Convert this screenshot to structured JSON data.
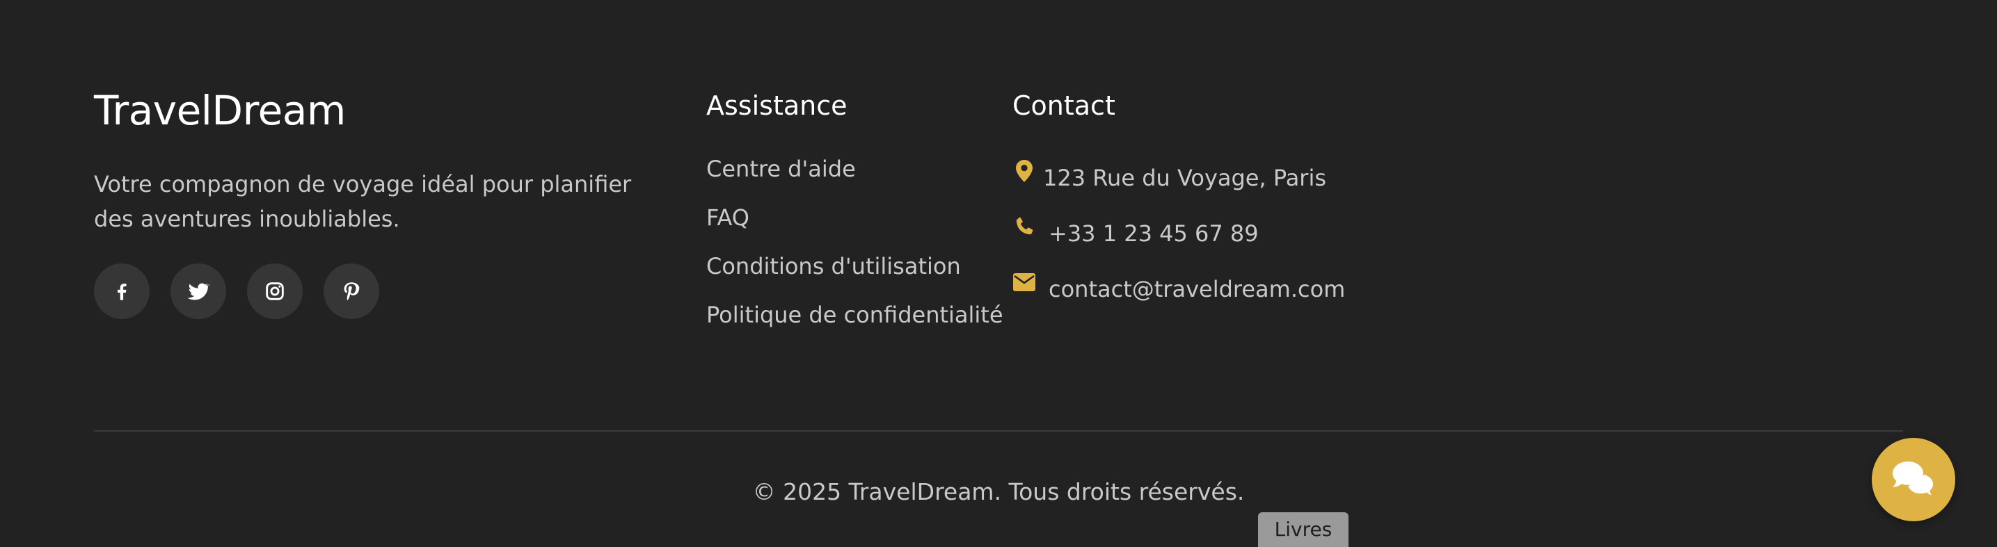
{
  "brand": {
    "title": "TravelDream",
    "description": "Votre compagnon de voyage idéal pour planifier des aventures inoubliables."
  },
  "social": [
    {
      "icon": "facebook-icon"
    },
    {
      "icon": "twitter-icon"
    },
    {
      "icon": "instagram-icon"
    },
    {
      "icon": "pinterest-icon"
    }
  ],
  "assistance": {
    "heading": "Assistance",
    "links": [
      {
        "label": "Centre d'aide"
      },
      {
        "label": "FAQ"
      },
      {
        "label": "Conditions d'utilisation"
      },
      {
        "label": "Politique de confidentialité"
      }
    ]
  },
  "contact": {
    "heading": "Contact",
    "address": "123 Rue du Voyage, Paris",
    "phone": "+33 1 23 45 67 89",
    "email": "contact@traveldream.com"
  },
  "footer": {
    "copyright": "© 2025 TravelDream. Tous droits réservés."
  },
  "chat": {
    "icon": "chat-bubbles-icon"
  },
  "tooltip": {
    "label": "Livres"
  },
  "colors": {
    "background": "#222222",
    "accent": "#deb344",
    "text_muted": "#c9c9c9",
    "heading": "#ffffff",
    "social_bg": "#363636"
  }
}
